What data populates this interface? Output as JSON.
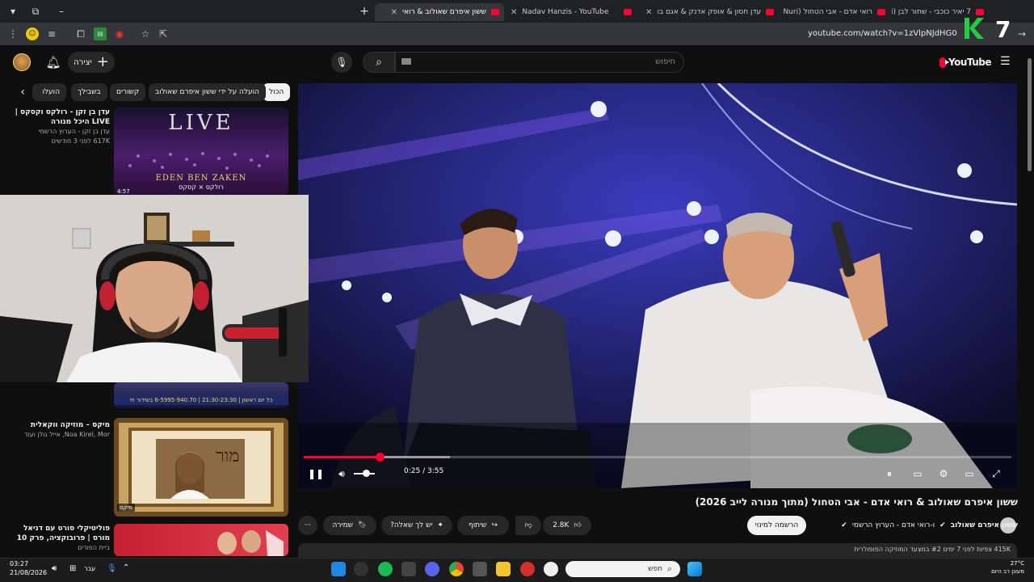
{
  "browser": {
    "tabs": [
      {
        "label": "7 יאיר כוכבי - שחור לבן (by Nuri",
        "active": false
      },
      {
        "label": "רואי אדם - אבי הטחול (By Nuri",
        "active": false
      },
      {
        "label": "עדן חסון & אופק אדנק & אגם בו",
        "active": false
      },
      {
        "label": "Nadav Hanzis - YouTube",
        "active": false
      },
      {
        "label": "ששון איפרם שאולוב & רואי",
        "active": true
      }
    ],
    "url": "youtube.com/watch?v=1zVlpNJdHG0",
    "new_tab_label": "+",
    "minimize_label": "–",
    "tab_close_label": "✕"
  },
  "youtube": {
    "logo_text": "YouTube",
    "logo_sup": "IL",
    "search_placeholder": "חיפוש",
    "create_label": "יצירה",
    "chips": [
      "הכול",
      "הועלה על ידי ששון איפרם שאולוב",
      "קשורים",
      "בשבילך",
      "הועלו"
    ],
    "player": {
      "progress_fraction": 0.107,
      "buffer_fraction": 0.207,
      "time": "0:25 / 3:55"
    },
    "video": {
      "title": "ששון איפרם שאולוב & רואי אדם - אבי הטחול (מתוך מנורה לייב 2026)",
      "channel": "ששון איפרם שאולוב",
      "channel_extra": "ו-רואי אדם - הערוץ הרשמי",
      "subscribe_label": "הרשמה למינוי",
      "likes": "2.8K",
      "share_label": "שיתוף",
      "ask_label": "יש לך שאלה?",
      "save_label": "שמירה",
      "more_label": "···",
      "description_line": "415K צפיות  לפני 7 ימים  #2 במצעד המוזיקה הפופולרית"
    },
    "recommendations": [
      {
        "title": "עדן בן זקן - רולקס וקסקס | LIVE היכל מנורה",
        "channel": "עדן בן זקן - הערוץ הרשמי",
        "meta": "617K  לפני 3 חודשים",
        "thumb_top": "LIVE",
        "thumb_bottom": "EDEN BEN ZAKEN",
        "thumb_sub": "רולקס × קסקס",
        "duration": "4:57"
      },
      {
        "title": "",
        "channel": "",
        "meta": "",
        "thumb_band": "כל יום ראשון | 21:30-23:30 | 6-5995-940.70 בשידור חי"
      },
      {
        "title": "מיקס – מוזיקה ווקאלית",
        "channel": "Noa Kirel, Mor, אייל גולן ועוד",
        "meta": "",
        "thumb_text": "מור",
        "badge": "מיקס"
      },
      {
        "title": "פוליטיקלי סורט עם דניאל מורס | פרובוקציה, פרק 10",
        "channel": "ביית הפודים",
        "meta": ""
      }
    ]
  },
  "taskbar": {
    "time": "03:27",
    "date": "21/08/2026",
    "lang": "עבר",
    "search_placeholder": "חפש",
    "weather_temp": "27°C",
    "weather_desc": "מעונן רב היום"
  },
  "stream_overlay": {
    "badge": "7"
  },
  "colors": {
    "accent": "#ff0033",
    "bg": "#0f0f0f",
    "chip": "#272727",
    "overlay_green": "#22cc44"
  }
}
